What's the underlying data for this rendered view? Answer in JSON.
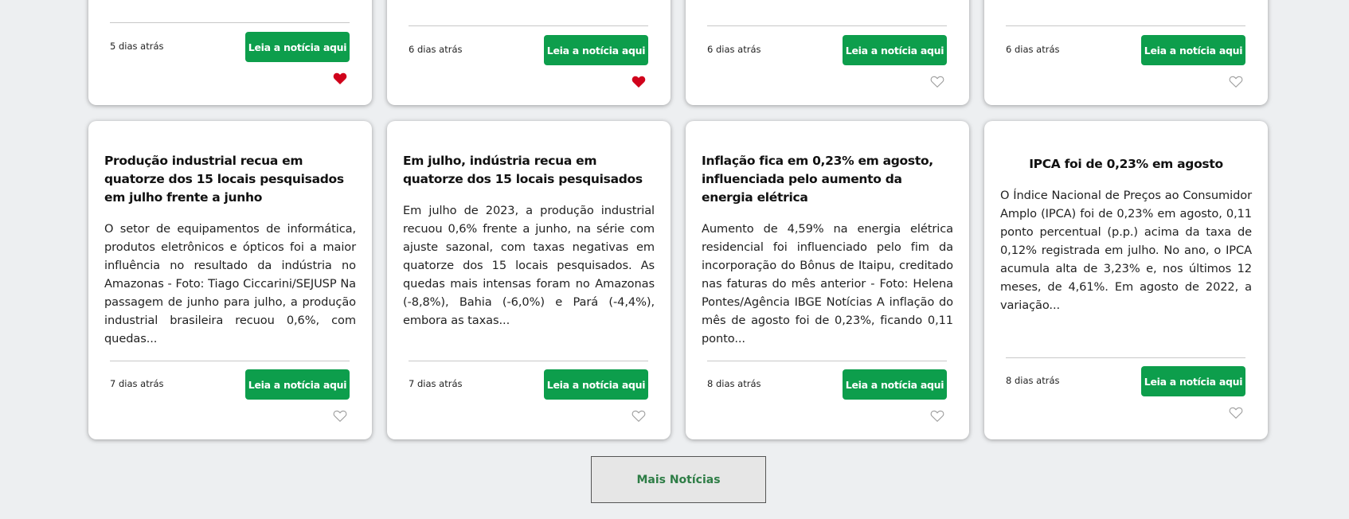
{
  "read_button_label": "Leia a notícia aqui",
  "more_button_label": "Mais Notícias",
  "colors": {
    "button_green": "#0d9e4c",
    "heart_liked": "#d0021b",
    "heart_outline": "#9a9a9a",
    "more_text": "#2e7d46"
  },
  "top_row": [
    {
      "date": "5 dias atrás",
      "liked": true
    },
    {
      "date": "6 dias atrás",
      "liked": true
    },
    {
      "date": "6 dias atrás",
      "liked": false
    },
    {
      "date": "6 dias atrás",
      "liked": false
    }
  ],
  "cards": [
    {
      "title": "Produção industrial recua em quatorze dos 15 locais pesquisados em julho frente a junho",
      "body": "O setor de equipamentos de informática, produtos eletrônicos e ópticos foi a maior influência no resultado da indústria no Amazonas - Foto: Tiago Ciccarini/SEJUSP Na passagem de junho para julho, a produção industrial brasileira recuou 0,6%, com quedas...",
      "date": "7 dias atrás",
      "liked": false
    },
    {
      "title": "Em julho, indústria recua em quatorze dos 15 locais pesquisados",
      "body": "Em julho de 2023, a produção industrial recuou 0,6% frente a junho, na série com ajuste sazonal, com taxas negativas em quatorze dos 15 locais pesquisados. As quedas mais intensas foram no Amazonas (-8,8%), Bahia (-6,0%) e Pará (-4,4%), embora as taxas...",
      "date": "7 dias atrás",
      "liked": false
    },
    {
      "title": "Inflação fica em 0,23% em agosto, influenciada pelo aumento da energia elétrica",
      "body": "Aumento de 4,59% na energia elétrica residencial foi influenciado pelo fim da incorporação do Bônus de Itaipu, creditado nas faturas do mês anterior - Foto: Helena Pontes/Agência IBGE Notícias A inflação do mês de agosto foi de 0,23%, ficando 0,11 ponto...",
      "date": "8 dias atrás",
      "liked": false
    },
    {
      "title": "IPCA foi de 0,23% em agosto",
      "body": "O Índice Nacional de Preços ao Consumidor Amplo (IPCA) foi de 0,23% em agosto, 0,11 ponto percentual (p.p.) acima da taxa de 0,12% registrada em julho. No ano, o IPCA acumula alta de 3,23% e, nos últimos 12 meses, de 4,61%. Em agosto de 2022, a variação...",
      "date": "8 dias atrás",
      "liked": false
    }
  ]
}
